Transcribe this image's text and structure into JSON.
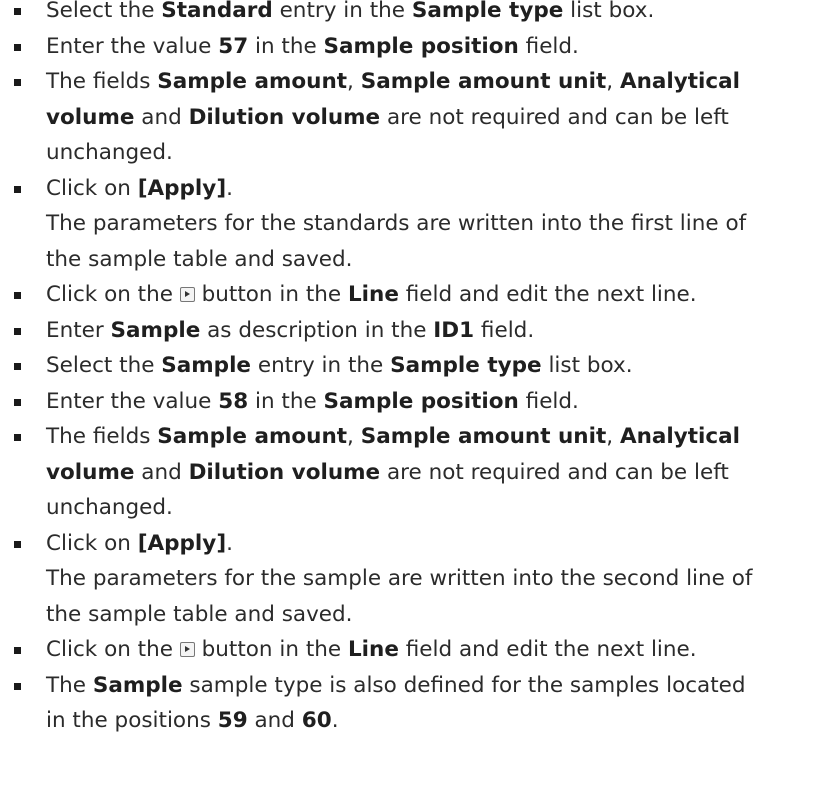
{
  "steps": [
    {
      "lines": [
        [
          [
            "Select the ",
            false
          ],
          [
            "Standard",
            true
          ],
          [
            " entry in the ",
            false
          ],
          [
            "Sample type",
            true
          ],
          [
            " list box.",
            false
          ]
        ]
      ]
    },
    {
      "lines": [
        [
          [
            "Enter the value ",
            false
          ],
          [
            "57",
            true
          ],
          [
            " in the ",
            false
          ],
          [
            "Sample position",
            true
          ],
          [
            " field.",
            false
          ]
        ]
      ]
    },
    {
      "lines": [
        [
          [
            "The fields ",
            false
          ],
          [
            "Sample amount",
            true
          ],
          [
            ", ",
            false
          ],
          [
            "Sample amount unit",
            true
          ],
          [
            ", ",
            false
          ],
          [
            "Analytical",
            true
          ]
        ],
        [
          [
            "volume",
            true
          ],
          [
            " and ",
            false
          ],
          [
            "Dilution volume",
            true
          ],
          [
            " are not required and can be left",
            false
          ]
        ],
        [
          [
            "unchanged.",
            false
          ]
        ]
      ]
    },
    {
      "lines": [
        [
          [
            "Click on ",
            false
          ],
          [
            "[Apply]",
            true
          ],
          [
            ".",
            false
          ]
        ],
        [
          [
            "The parameters for the standards are written into the first line of",
            false
          ]
        ],
        [
          [
            "the sample table and saved.",
            false
          ]
        ]
      ]
    },
    {
      "lines": [
        [
          [
            "Click on the ",
            false
          ],
          [
            "@next-icon",
            false
          ],
          [
            " button in the ",
            false
          ],
          [
            "Line",
            true
          ],
          [
            " field and edit the next line.",
            false
          ]
        ]
      ]
    },
    {
      "lines": [
        [
          [
            "Enter ",
            false
          ],
          [
            "Sample",
            true
          ],
          [
            " as description in the ",
            false
          ],
          [
            "ID1",
            true
          ],
          [
            " field.",
            false
          ]
        ]
      ]
    },
    {
      "lines": [
        [
          [
            "Select the ",
            false
          ],
          [
            "Sample",
            true
          ],
          [
            " entry in the ",
            false
          ],
          [
            "Sample type",
            true
          ],
          [
            " list box.",
            false
          ]
        ]
      ]
    },
    {
      "lines": [
        [
          [
            "Enter the value ",
            false
          ],
          [
            "58",
            true
          ],
          [
            " in the ",
            false
          ],
          [
            "Sample position",
            true
          ],
          [
            " field.",
            false
          ]
        ]
      ]
    },
    {
      "lines": [
        [
          [
            "The fields ",
            false
          ],
          [
            "Sample amount",
            true
          ],
          [
            ", ",
            false
          ],
          [
            "Sample amount unit",
            true
          ],
          [
            ", ",
            false
          ],
          [
            "Analytical",
            true
          ]
        ],
        [
          [
            "volume",
            true
          ],
          [
            " and ",
            false
          ],
          [
            "Dilution volume",
            true
          ],
          [
            " are not required and can be left",
            false
          ]
        ],
        [
          [
            "unchanged.",
            false
          ]
        ]
      ]
    },
    {
      "lines": [
        [
          [
            "Click on ",
            false
          ],
          [
            "[Apply]",
            true
          ],
          [
            ".",
            false
          ]
        ],
        [
          [
            "The parameters for the sample are written into the second line of",
            false
          ]
        ],
        [
          [
            "the sample table and saved.",
            false
          ]
        ]
      ]
    },
    {
      "lines": [
        [
          [
            "Click on the ",
            false
          ],
          [
            "@next-icon",
            false
          ],
          [
            " button in the ",
            false
          ],
          [
            "Line",
            true
          ],
          [
            " field and edit the next line.",
            false
          ]
        ]
      ]
    },
    {
      "lines": [
        [
          [
            "The ",
            false
          ],
          [
            "Sample",
            true
          ],
          [
            " sample type is also defined for the samples located",
            false
          ]
        ],
        [
          [
            "in the positions ",
            false
          ],
          [
            "59",
            true
          ],
          [
            " and ",
            false
          ],
          [
            "60",
            true
          ],
          [
            ".",
            false
          ]
        ]
      ]
    }
  ]
}
